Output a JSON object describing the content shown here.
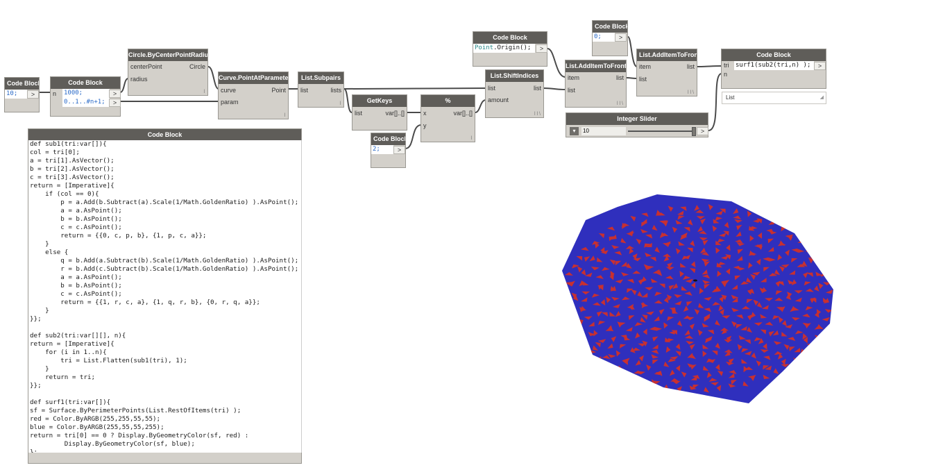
{
  "nodes": {
    "cb10": {
      "title": "Code Block",
      "code": "10;",
      "out": ">"
    },
    "cb1000": {
      "title": "Code Block",
      "in_n": "n",
      "line1": "1000;",
      "line2": "0..1..#n+1;",
      "out": ">"
    },
    "circle": {
      "title": "Circle.ByCenterPointRadius",
      "in1": "centerPoint",
      "in2": "radius",
      "out": "Circle",
      "foot": "l"
    },
    "curvept": {
      "title": "Curve.PointAtParameter",
      "in1": "curve",
      "in2": "param",
      "out": "Point",
      "foot": "l"
    },
    "subpairs": {
      "title": "List.Subpairs",
      "in1": "list",
      "out": "lists",
      "foot": "l"
    },
    "getkeys": {
      "title": "GetKeys",
      "in1": "list",
      "out": "var[]..[]"
    },
    "cb2": {
      "title": "Code Block",
      "code": "2;",
      "out": ">"
    },
    "mod": {
      "title": "%",
      "in1": "x",
      "in2": "y",
      "out": "var[]..[]",
      "foot": "l"
    },
    "cborigin": {
      "title": "Code Block",
      "code_cls": "Point",
      "code_rest": ".Origin();",
      "out": ">"
    },
    "shift": {
      "title": "List.ShiftIndices",
      "in1": "list",
      "in2": "amount",
      "out": "list",
      "foot": "l l \\"
    },
    "addfront1": {
      "title": "List.AddItemToFront",
      "in1": "item",
      "in2": "list",
      "out": "list",
      "foot": "l l \\"
    },
    "cb0": {
      "title": "Code Block",
      "code": "0;",
      "out": ">"
    },
    "addfront2": {
      "title": "List.AddItemToFront",
      "in1": "item",
      "in2": "list",
      "out": "list",
      "foot": "l l \\"
    },
    "cbsurf": {
      "title": "Code Block",
      "in1": "tri",
      "in2": "n",
      "code": "surf1(sub2(tri,n) );",
      "out": ">",
      "watch": "List"
    },
    "slider": {
      "title": "Integer Slider",
      "value": "10",
      "out": ">"
    },
    "bigcb": {
      "title": "Code Block"
    }
  },
  "bigcode_lines": [
    "def sub1(tri:var[]){",
    "col = tri[0];",
    "a = tri[1].AsVector();",
    "b = tri[2].AsVector();",
    "c = tri[3].AsVector();",
    "return = [Imperative]{",
    "    if (col == 0){",
    "        p = a.Add(b.Subtract(a).Scale(1/Math.GoldenRatio) ).AsPoint();",
    "        a = a.AsPoint();",
    "        b = b.AsPoint();",
    "        c = c.AsPoint();",
    "        return = {{0, c, p, b}, {1, p, c, a}};",
    "    }",
    "    else {",
    "        q = b.Add(a.Subtract(b).Scale(1/Math.GoldenRatio) ).AsPoint();",
    "        r = b.Add(c.Subtract(b).Scale(1/Math.GoldenRatio) ).AsPoint();",
    "        a = a.AsPoint();",
    "        b = b.AsPoint();",
    "        c = c.AsPoint();",
    "        return = {{1, r, c, a}, {1, q, r, b}, {0, r, q, a}};",
    "    }",
    "}};",
    "",
    "def sub2(tri:var[][], n){",
    "return = [Imperative]{",
    "    for (i in 1..n){",
    "        tri = List.Flatten(sub1(tri), 1);",
    "    }",
    "    return = tri;",
    "}};",
    "",
    "def surf1(tri:var[]){",
    "sf = Surface.ByPerimeterPoints(List.RestOfItems(tri) );",
    "red = Color.ByARGB(255,255,55,55);",
    "blue = Color.ByARGB(255,55,55,255);",
    "return = tri[0] == 0 ? Display.ByGeometryColor(sf, red) :",
    "         Display.ByGeometryColor(sf, blue);",
    "};"
  ],
  "colors": {
    "red": "#c83030",
    "blue": "#2f2fbd",
    "header": "#5f5d59",
    "node": "#d3d0ca"
  },
  "preview": {
    "type": "penrose-tiling-decagon"
  }
}
